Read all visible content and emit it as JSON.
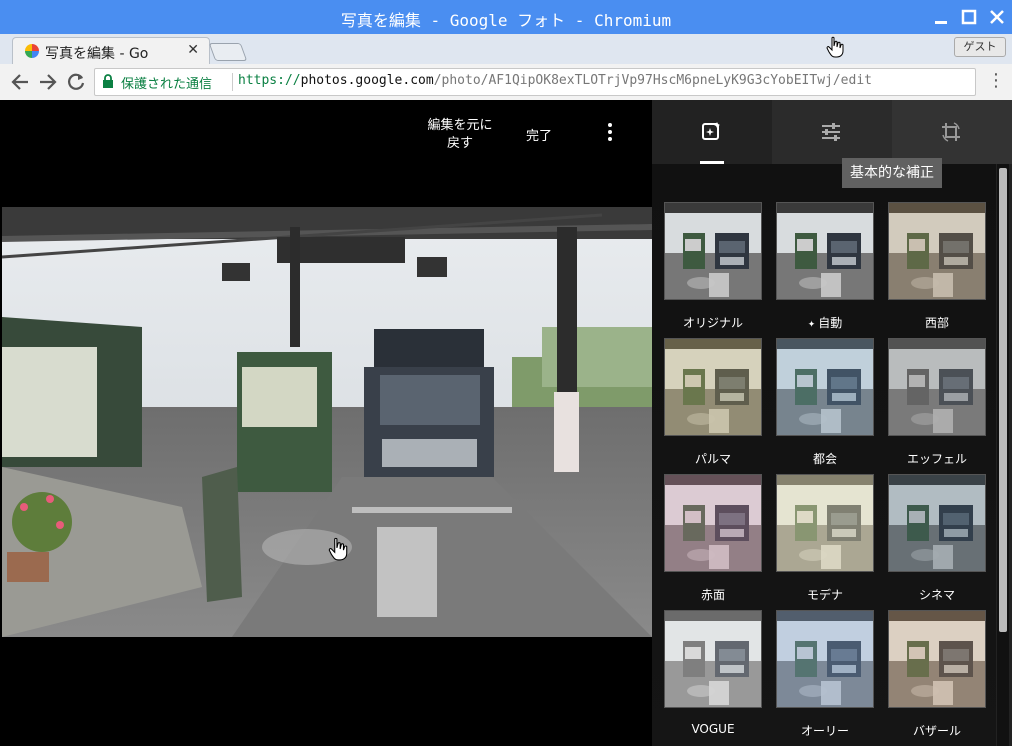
{
  "window": {
    "title": "写真を編集 - Google フォト - Chromium"
  },
  "tab": {
    "title": "写真を編集 - Go"
  },
  "profile": {
    "label": "ゲスト"
  },
  "omnibox": {
    "security_label": "保護された通信",
    "url_scheme": "https://",
    "url_host": "photos.google.com",
    "url_path": "/photo/AF1QipOK8exTLOTrjVp97HscM6pneLyK9G3cYobEITwj/edit"
  },
  "editor": {
    "undo_label_line1": "編集を元に",
    "undo_label_line2": "戻す",
    "done_label": "完了",
    "tooltip": "基本的な補正",
    "filters": [
      {
        "label": "オリジナル",
        "tint": "none"
      },
      {
        "label": "自動",
        "tint": "none"
      },
      {
        "label": "西部",
        "tint": "warm"
      },
      {
        "label": "パルマ",
        "tint": "palma"
      },
      {
        "label": "都会",
        "tint": "cool"
      },
      {
        "label": "エッフェル",
        "tint": "gray"
      },
      {
        "label": "赤面",
        "tint": "pink"
      },
      {
        "label": "モデナ",
        "tint": "cream"
      },
      {
        "label": "シネマ",
        "tint": "cinema"
      },
      {
        "label": "VOGUE",
        "tint": "vogue"
      },
      {
        "label": "オーリー",
        "tint": "cool2"
      },
      {
        "label": "バザール",
        "tint": "warm2"
      }
    ]
  },
  "colors": {
    "titlebar": "#4a8ef1",
    "secure_green": "#0b8043",
    "panel_bg": "#222222",
    "tooltip_bg": "#616161"
  },
  "icons": [
    "chromium-icon",
    "close-icon",
    "back-arrow-icon",
    "forward-arrow-icon",
    "reload-icon",
    "lock-icon",
    "more-vert-icon",
    "filters-icon",
    "adjust-sliders-icon",
    "crop-rotate-icon",
    "hand-cursor-icon",
    "auto-sparkle-icon"
  ]
}
